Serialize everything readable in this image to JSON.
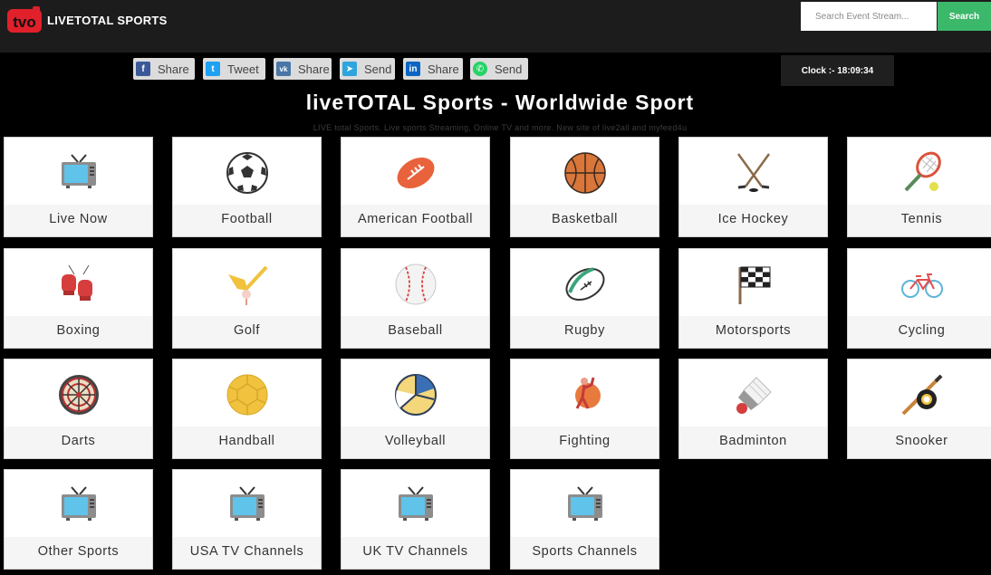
{
  "header": {
    "brand": "LIVETOTAL SPORTS",
    "logo_text": "tvo",
    "search": {
      "placeholder": "Search Event Stream...",
      "button_label": "Search"
    },
    "clock_text": "Clock :- 18:09:34"
  },
  "share_buttons": [
    {
      "label": "Share",
      "icon": "facebook-icon",
      "color": "#3b5998"
    },
    {
      "label": "Tweet",
      "icon": "twitter-icon",
      "color": "#1da1f2"
    },
    {
      "label": "Share",
      "icon": "vk-icon",
      "color": "#4a76a8"
    },
    {
      "label": "Send",
      "icon": "telegram-icon",
      "color": "#2fa5dd"
    },
    {
      "label": "Share",
      "icon": "linkedin-icon",
      "color": "#0a66c2"
    },
    {
      "label": "Send",
      "icon": "whatsapp-icon",
      "color": "#25d366"
    }
  ],
  "main": {
    "title": "liveTOTAL Sports - Worldwide Sport",
    "tagline": "LIVE total Sports. Live sports Streaming, Online TV and more. New site of live2all and myfeed4u"
  },
  "categories": [
    {
      "label": "Live Now",
      "icon": "tv-icon"
    },
    {
      "label": "Football",
      "icon": "soccer-ball-icon"
    },
    {
      "label": "American Football",
      "icon": "american-football-icon"
    },
    {
      "label": "Basketball",
      "icon": "basketball-icon"
    },
    {
      "label": "Ice Hockey",
      "icon": "hockey-sticks-icon"
    },
    {
      "label": "Tennis",
      "icon": "tennis-racket-icon"
    },
    {
      "label": "Boxing",
      "icon": "boxing-gloves-icon"
    },
    {
      "label": "Golf",
      "icon": "golf-club-icon"
    },
    {
      "label": "Baseball",
      "icon": "baseball-icon"
    },
    {
      "label": "Rugby",
      "icon": "rugby-ball-icon"
    },
    {
      "label": "Motorsports",
      "icon": "checkered-flag-icon"
    },
    {
      "label": "Cycling",
      "icon": "bicycle-icon"
    },
    {
      "label": "Darts",
      "icon": "dartboard-icon"
    },
    {
      "label": "Handball",
      "icon": "handball-icon"
    },
    {
      "label": "Volleyball",
      "icon": "volleyball-icon"
    },
    {
      "label": "Fighting",
      "icon": "fighter-icon"
    },
    {
      "label": "Badminton",
      "icon": "shuttlecock-icon"
    },
    {
      "label": "Snooker",
      "icon": "snooker-cue-icon"
    },
    {
      "label": "Other Sports",
      "icon": "tv-icon"
    },
    {
      "label": "USA TV Channels",
      "icon": "tv-icon"
    },
    {
      "label": "UK TV Channels",
      "icon": "tv-icon"
    },
    {
      "label": "Sports Channels",
      "icon": "tv-icon"
    }
  ]
}
